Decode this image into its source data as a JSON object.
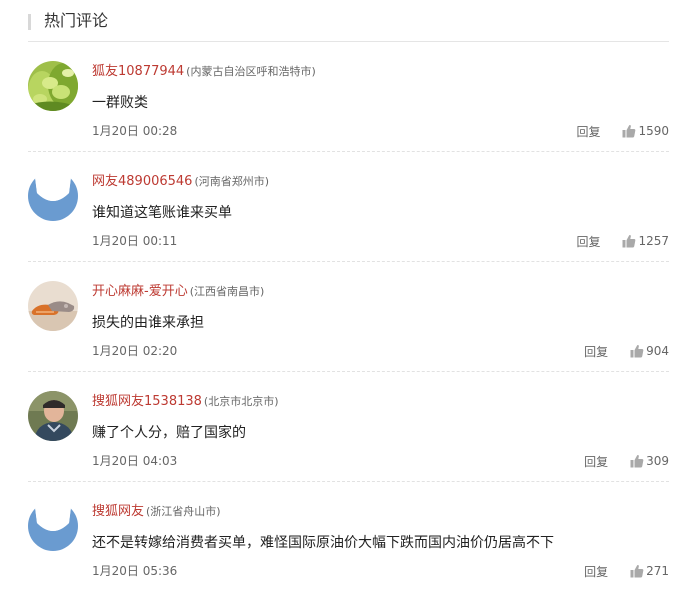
{
  "header": {
    "title": "热门评论"
  },
  "comments": [
    {
      "username": "狐友10877944",
      "location": "(内蒙古自治区呼和浩特市)",
      "content": "一群败类",
      "time": "1月20日 00:28",
      "reply_label": "回复",
      "likes": "1590",
      "avatar": "green-beans-avatar"
    },
    {
      "username": "网友489006546",
      "location": "(河南省郑州市)",
      "content": "谁知道这笔账谁来买单",
      "time": "1月20日 00:11",
      "reply_label": "回复",
      "likes": "1257",
      "avatar": "default-fox-avatar"
    },
    {
      "username": "开心麻麻-爱开心",
      "location": "(江西省南昌市)",
      "content": "损失的由谁来承担",
      "time": "1月20日 02:20",
      "reply_label": "回复",
      "likes": "904",
      "avatar": "shoes-avatar"
    },
    {
      "username": "搜狐网友1538138",
      "location": "(北京市北京市)",
      "content": "赚了个人分，赔了国家的",
      "time": "1月20日 04:03",
      "reply_label": "回复",
      "likes": "309",
      "avatar": "person-photo-avatar"
    },
    {
      "username": "搜狐网友",
      "location": "(浙江省舟山市)",
      "content": "还不是转嫁给消费者买单，难怪国际原油价大幅下跌而国内油价仍居高不下",
      "time": "1月20日 05:36",
      "reply_label": "回复",
      "likes": "271",
      "avatar": "default-fox-avatar"
    }
  ],
  "colors": {
    "username": "#bd3a32",
    "meta": "#666666",
    "text": "#222222",
    "icon": "#a9a9a9"
  }
}
